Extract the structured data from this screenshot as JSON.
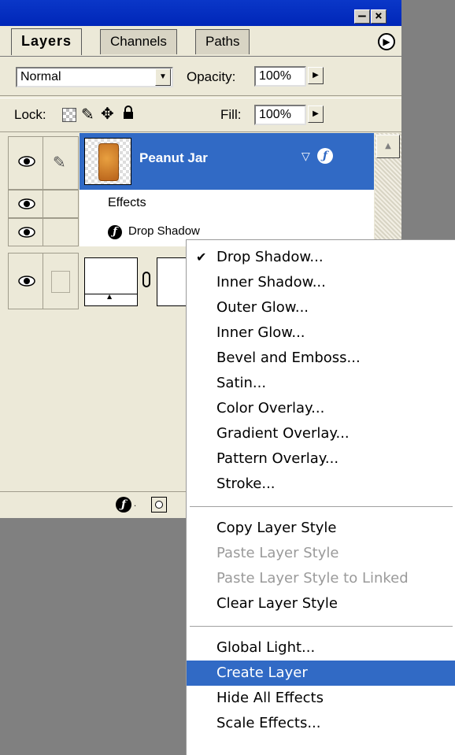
{
  "tabs": [
    {
      "label": "Layers"
    },
    {
      "label": "Channels"
    },
    {
      "label": "Paths"
    }
  ],
  "blend_mode": "Normal",
  "opacity": {
    "label": "Opacity:",
    "value": "100%"
  },
  "lock": {
    "label": "Lock:"
  },
  "fill": {
    "label": "Fill:",
    "value": "100%"
  },
  "layers": {
    "active_name": "Peanut Jar",
    "effects_label": "Effects",
    "effect_item": "Drop Shadow"
  },
  "context_menu": {
    "items": [
      "Drop Shadow...",
      "Inner Shadow...",
      "Outer Glow...",
      "Inner Glow...",
      "Bevel and Emboss...",
      "Satin...",
      "Color Overlay...",
      "Gradient Overlay...",
      "Pattern Overlay...",
      "Stroke...",
      "Copy Layer Style",
      "Paste Layer Style",
      "Paste Layer Style to Linked",
      "Clear Layer Style",
      "Global Light...",
      "Create Layer",
      "Hide All Effects",
      "Scale Effects..."
    ],
    "checked_item": "Drop Shadow...",
    "disabled_items": [
      "Paste Layer Style",
      "Paste Layer Style to Linked"
    ],
    "highlighted_item": "Create Layer"
  },
  "colors": {
    "selection": "#316ac5",
    "titlebar": "#0026b8",
    "panel": "#ece9d8"
  },
  "icons": [
    "minimize-icon",
    "close-icon",
    "panel-menu-arrow-icon",
    "dropdown-arrow-icon",
    "lock-transparency-icon",
    "lock-paint-icon",
    "lock-move-icon",
    "lock-all-icon",
    "eye-icon",
    "brush-icon",
    "layer-thumbnail",
    "fx-icon",
    "link-chain-icon",
    "add-layer-style-icon",
    "add-mask-icon",
    "checkmark-icon"
  ]
}
